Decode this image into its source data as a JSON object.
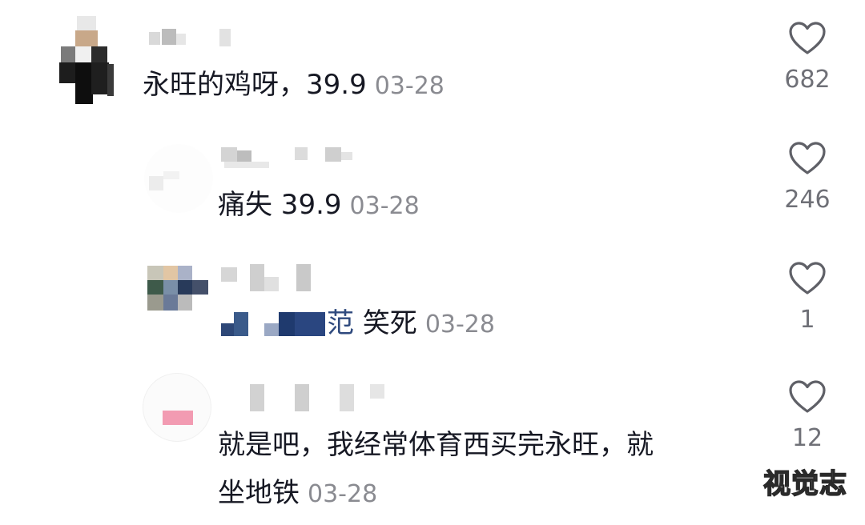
{
  "comments": [
    {
      "text": "永旺的鸡呀，39.9",
      "time": "03-28",
      "likes": "682"
    },
    {
      "text": "痛失 39.9",
      "time": "03-28",
      "likes": "246"
    },
    {
      "text": "笑死",
      "text_prefix": "范",
      "time": "03-28",
      "likes": "1"
    },
    {
      "text_line1": "就是吧，我经常体育西买完永旺，就",
      "text_line2": "坐地铁",
      "time": "03-28",
      "likes": "12"
    }
  ],
  "watermark": "视觉志",
  "colors": {
    "text": "#161823",
    "time": "#8a8b91",
    "count": "#6f7077",
    "heart_stroke": "#5f6067"
  }
}
